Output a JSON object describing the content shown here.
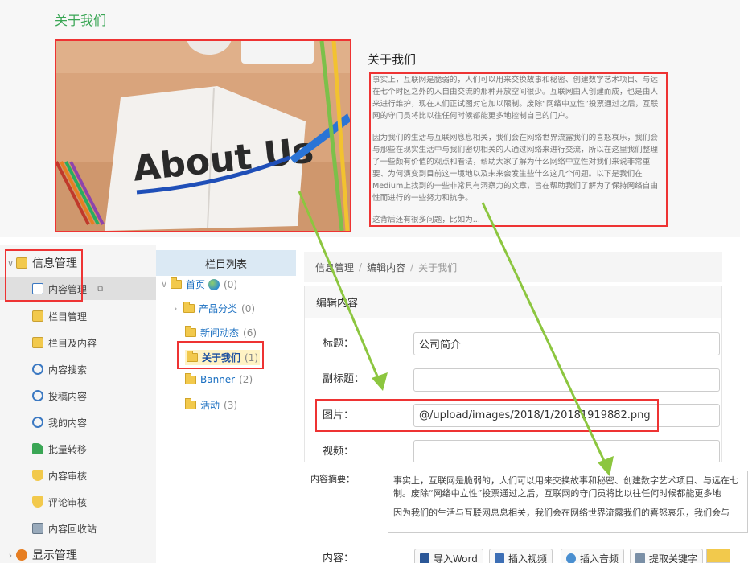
{
  "about": {
    "heading": "关于我们",
    "image_text": "About Us",
    "title": "关于我们",
    "paragraphs": [
      "事实上，互联网是脆弱的，人们可以用来交换故事和秘密、创建数字艺术项目、与远在七个时区之外的人自由交流的那种开放空间很少。互联网由人创建而成，也是由人来进行维护，现在人们正试图对它加以限制。废除“网络中立性”投票通过之后，互联网的守门员将比以往任何时候都能更多地控制自己的门户。",
      "因为我们的生活与互联网息息相关，我们会在网络世界流露我们的喜怒哀乐，我们会与那些在现实生活中与我们密切相关的人通过网络来进行交流，所以在这里我们整理了一些颇有价值的观点和看法，帮助大家了解为什么网络中立性对我们来说非常重要、为何演变到目前这一境地以及未来会发生些什么这几个问题。以下是我们在Medium上找到的一些非常具有洞察力的文章，旨在帮助我们了解为了保持网络自由性而进行的一些努力和抗争。",
      "这背后还有很多问题，比如为..."
    ]
  },
  "sidebar": {
    "group_info": "信息管理",
    "group_display": "显示管理",
    "items": [
      {
        "label": "内容管理",
        "icon": "content-icon"
      },
      {
        "label": "栏目管理",
        "icon": "folder-icon"
      },
      {
        "label": "栏目及内容",
        "icon": "folder-doc-icon"
      },
      {
        "label": "内容搜索",
        "icon": "search-icon"
      },
      {
        "label": "投稿内容",
        "icon": "search-icon"
      },
      {
        "label": "我的内容",
        "icon": "search-icon"
      },
      {
        "label": "批量转移",
        "icon": "arrow-icon"
      },
      {
        "label": "内容审核",
        "icon": "shield-icon"
      },
      {
        "label": "评论审核",
        "icon": "shield-icon"
      },
      {
        "label": "内容回收站",
        "icon": "recycle-icon"
      }
    ]
  },
  "column_tree": {
    "header": "栏目列表",
    "nodes": [
      {
        "label": "首页",
        "count": "(0)"
      },
      {
        "label": "产品分类",
        "count": "(0)"
      },
      {
        "label": "新闻动态",
        "count": "(6)"
      },
      {
        "label": "关于我们",
        "count": "(1)"
      },
      {
        "label": "Banner",
        "count": "(2)"
      },
      {
        "label": "活动",
        "count": "(3)"
      }
    ]
  },
  "editor": {
    "breadcrumb": [
      "信息管理",
      "编辑内容",
      "关于我们"
    ],
    "card_title": "编辑内容",
    "labels": {
      "title": "标题：",
      "subtitle": "副标题：",
      "image": "图片：",
      "video": "视频：",
      "summary": "内容摘要：",
      "content": "内容："
    },
    "values": {
      "title": "公司简介",
      "subtitle": "",
      "image": "@/upload/images/2018/1/20181919882.png",
      "video": ""
    },
    "summary_lines": [
      "事实上，互联网是脆弱的，人们可以用来交换故事和秘密、创建数字艺术项目、与远在七",
      "制。废除“网络中立性”投票通过之后，互联网的守门员将比以往任何时候都能更多地",
      "因为我们的生活与互联网息息相关，我们会在网络世界流露我们的喜怒哀乐，我们会与"
    ],
    "toolbar": [
      "导入Word",
      "插入视频",
      "插入音频",
      "提取关键字"
    ]
  },
  "colors": {
    "accent_green": "#3aa655",
    "highlight_red": "#e33333",
    "arrow_green": "#8cc63f",
    "link_blue": "#1a6fc1"
  }
}
